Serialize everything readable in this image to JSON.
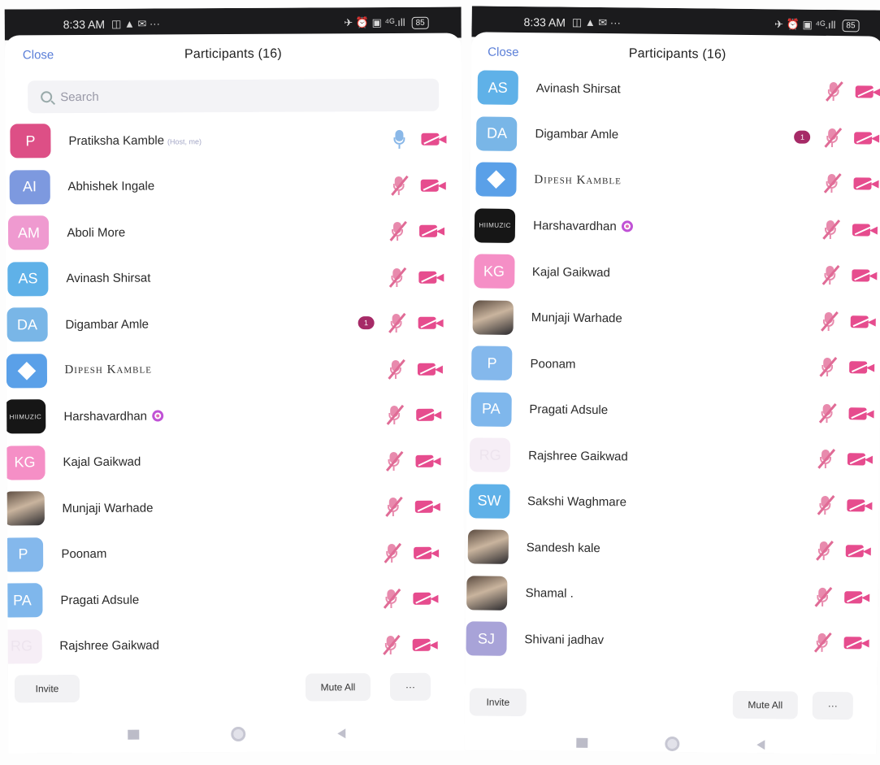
{
  "left": {
    "status": {
      "time": "8:33 AM",
      "left_icons": "◫ ▲ ✉ ···",
      "right_icons": "✈ ⏰ ▣ ⁴ᴳ.ıll",
      "battery": "85"
    },
    "header": {
      "close": "Close",
      "title": "Participants (16)"
    },
    "search": {
      "placeholder": "Search"
    },
    "participants": [
      {
        "initials": "P",
        "name": "Pratiksha Kamble",
        "tag": "(Host, me)",
        "color": "#dd4f86",
        "mic": "on"
      },
      {
        "initials": "AI",
        "name": "Abhishek Ingale",
        "color": "#7d99df"
      },
      {
        "initials": "AM",
        "name": "Aboli More",
        "color": "#ef9ad0"
      },
      {
        "initials": "AS",
        "name": "Avinash Shirsat",
        "color": "#5fb1e8"
      },
      {
        "initials": "DA",
        "name": "Digambar Amle",
        "color": "#79b6e7",
        "badge": "1"
      },
      {
        "initials": "",
        "name": "Dipesh Kamble",
        "avatar": "diamond"
      },
      {
        "initials": "HIIMUZIC",
        "name": "Harshavardhan",
        "avatar": "black",
        "ring": true
      },
      {
        "initials": "KG",
        "name": "Kajal Gaikwad",
        "color": "#f58fc6"
      },
      {
        "initials": "",
        "name": "Munjaji Warhade",
        "avatar": "photo"
      },
      {
        "initials": "P",
        "name": "Poonam",
        "color": "#84b8ec"
      },
      {
        "initials": "PA",
        "name": "Pragati Adsule",
        "color": "#7fb7ec"
      },
      {
        "initials": "RG",
        "name": "Rajshree Gaikwad",
        "color": "#f6eef6"
      }
    ],
    "bottom": {
      "invite": "Invite",
      "mute_all": "Mute All",
      "more": "···"
    }
  },
  "right": {
    "status": {
      "time": "8:33 AM",
      "left_icons": "◫ ▲ ✉ ···",
      "right_icons": "✈ ⏰ ▣ ⁴ᴳ.ıll",
      "battery": "85"
    },
    "header": {
      "close": "Close",
      "title": "Participants (16)"
    },
    "participants": [
      {
        "initials": "AS",
        "name": "Avinash Shirsat",
        "color": "#5fb1e8"
      },
      {
        "initials": "DA",
        "name": "Digambar Amle",
        "color": "#79b6e7",
        "badge": "1"
      },
      {
        "initials": "",
        "name": "Dipesh Kamble",
        "avatar": "diamond"
      },
      {
        "initials": "HIIMUZIC",
        "name": "Harshavardhan",
        "avatar": "black",
        "ring": true
      },
      {
        "initials": "KG",
        "name": "Kajal Gaikwad",
        "color": "#f58fc6"
      },
      {
        "initials": "",
        "name": "Munjaji Warhade",
        "avatar": "photo"
      },
      {
        "initials": "P",
        "name": "Poonam",
        "color": "#84b8ec"
      },
      {
        "initials": "PA",
        "name": "Pragati Adsule",
        "color": "#7fb7ec"
      },
      {
        "initials": "RG",
        "name": "Rajshree Gaikwad",
        "color": "#f6eef6"
      },
      {
        "initials": "SW",
        "name": "Sakshi Waghmare",
        "color": "#5fb1e8"
      },
      {
        "initials": "",
        "name": "Sandesh kale",
        "avatar": "photo"
      },
      {
        "initials": "",
        "name": "Shamal .",
        "avatar": "photo"
      },
      {
        "initials": "SJ",
        "name": "Shivani jadhav",
        "color": "#a8a3d8"
      }
    ],
    "bottom": {
      "invite": "Invite",
      "mute_all": "Mute All",
      "more": "···"
    }
  }
}
